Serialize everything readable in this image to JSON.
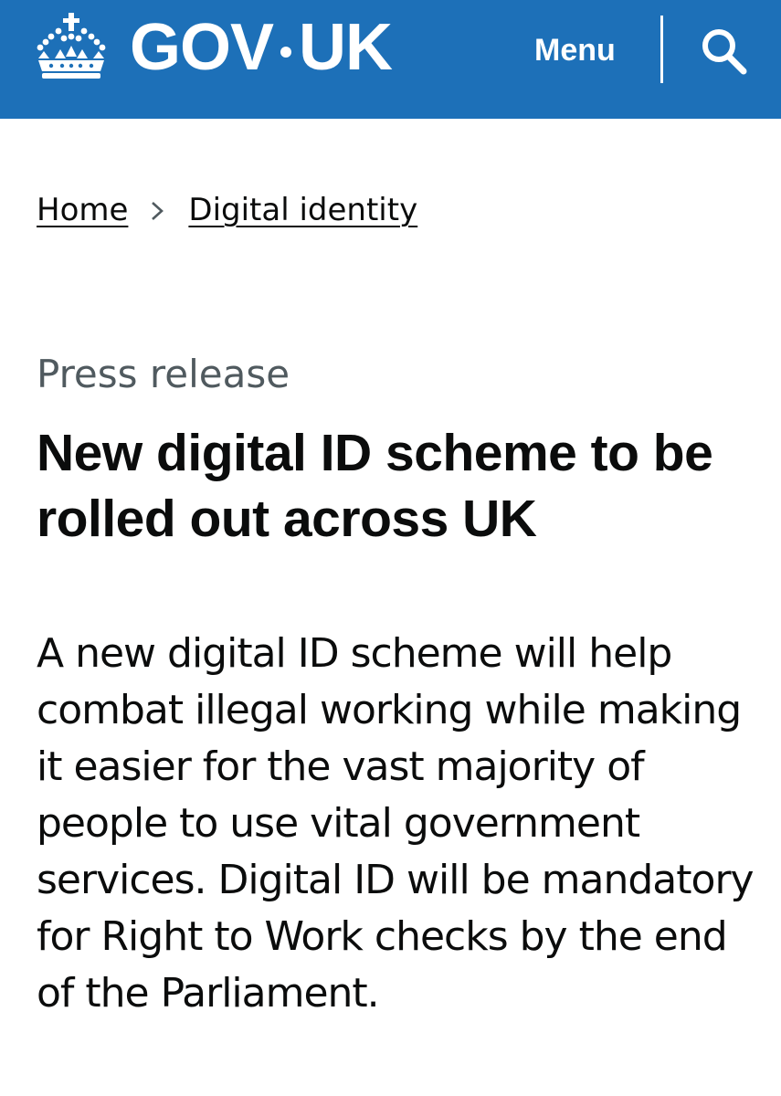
{
  "header": {
    "logo_text_left": "GOV",
    "logo_text_right": "UK",
    "menu_label": "Menu",
    "search_icon": "search-icon",
    "crown_icon": "crown-icon",
    "background_color": "#1d70b8"
  },
  "breadcrumb": {
    "items": [
      {
        "label": "Home"
      },
      {
        "label": "Digital identity"
      }
    ],
    "separator_icon": "chevron-right-icon"
  },
  "main": {
    "document_type": "Press release",
    "title": "New digital ID scheme to be rolled out across UK",
    "lead": "A new digital ID scheme will help combat illegal working while making it easier for the vast majority of people to use vital government services. Digital ID will be mandatory for Right to Work checks by the end of the Parliament."
  }
}
